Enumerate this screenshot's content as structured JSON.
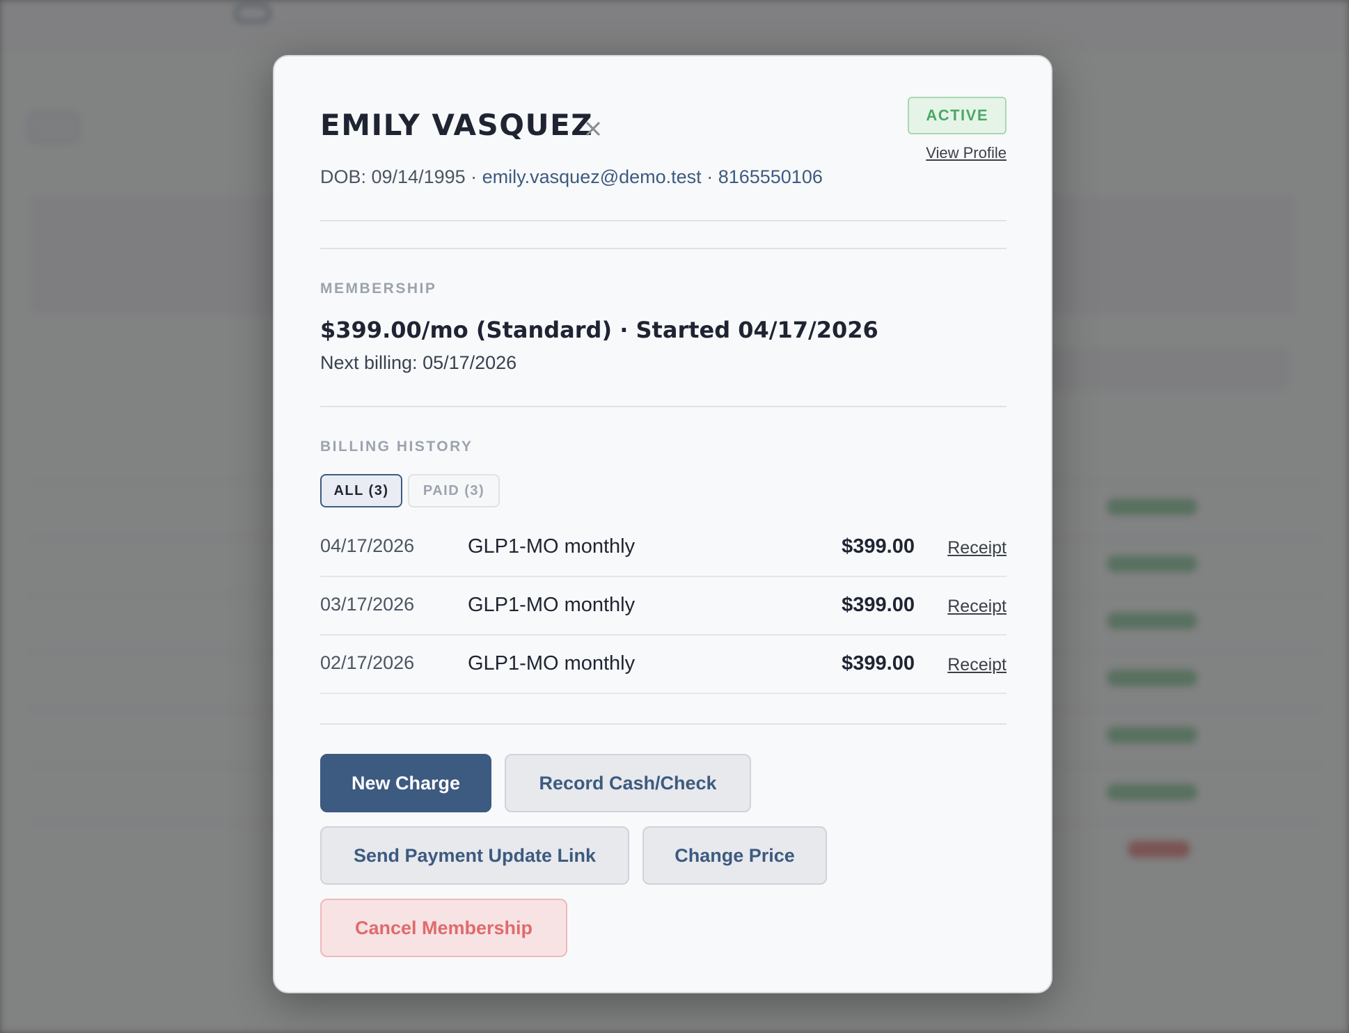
{
  "modal": {
    "patient_name": "EMILY VASQUEZ",
    "status_badge": "ACTIVE",
    "view_profile_label": "View Profile",
    "dob_text": "DOB: 09/14/1995 · ",
    "email": "emily.vasquez@demo.test",
    "separator": " · ",
    "phone": "8165550106",
    "close_icon": "close-icon",
    "membership": {
      "section_label": "MEMBERSHIP",
      "plan_summary": "$399.00/mo (Standard) · Started 04/17/2026",
      "next_billing": "Next billing: 05/17/2026"
    },
    "billing_history": {
      "section_label": "BILLING HISTORY",
      "tabs": [
        {
          "label": "ALL (3)",
          "active": true
        },
        {
          "label": "PAID (3)",
          "active": false
        }
      ],
      "rows": [
        {
          "date": "04/17/2026",
          "description": "GLP1-MO monthly",
          "amount": "$399.00",
          "link": "Receipt"
        },
        {
          "date": "03/17/2026",
          "description": "GLP1-MO monthly",
          "amount": "$399.00",
          "link": "Receipt"
        },
        {
          "date": "02/17/2026",
          "description": "GLP1-MO monthly",
          "amount": "$399.00",
          "link": "Receipt"
        }
      ]
    },
    "actions": {
      "new_charge": "New Charge",
      "record_cash_check": "Record Cash/Check",
      "send_payment_update_link": "Send Payment Update Link",
      "change_price": "Change Price",
      "cancel_membership": "Cancel Membership"
    }
  },
  "colors": {
    "primary": "#3d5a80",
    "active_green": "#48a964",
    "danger_red": "#e06b6b",
    "backdrop": "#7d7d7d"
  }
}
